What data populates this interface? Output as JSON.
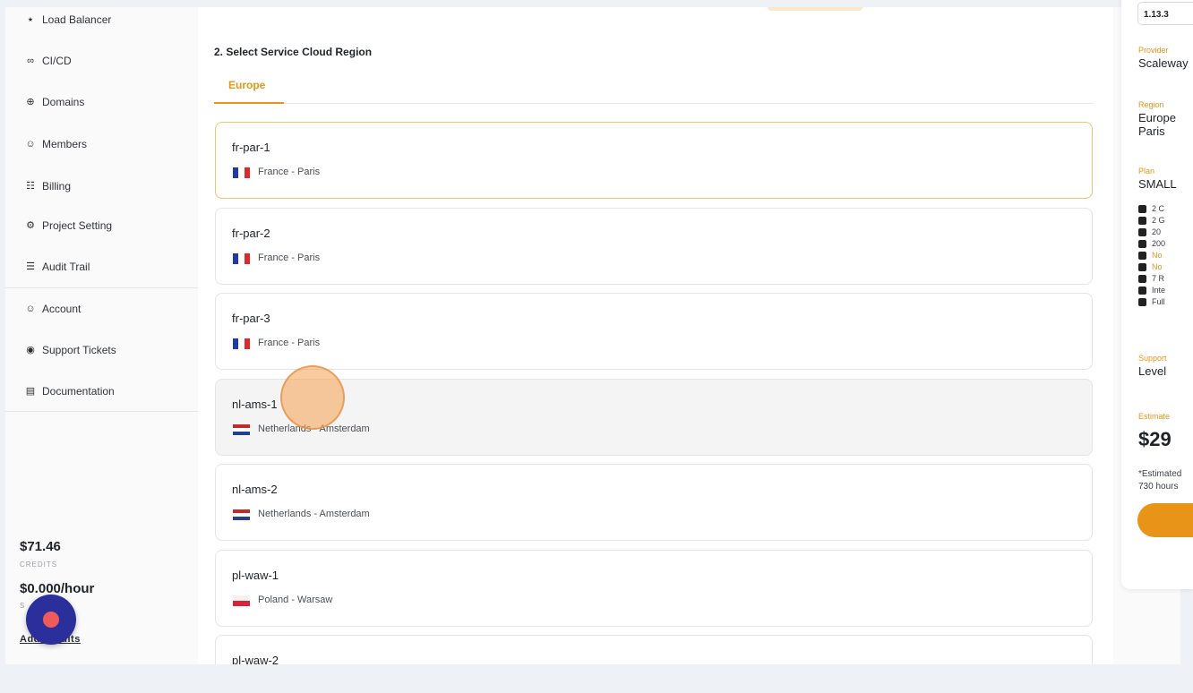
{
  "sidebar": {
    "items": [
      {
        "label": "Load Balancer",
        "icon": "load-balancer-icon"
      },
      {
        "label": "CI/CD",
        "icon": "infinity-icon"
      },
      {
        "label": "Domains",
        "icon": "globe-icon"
      },
      {
        "label": "Members",
        "icon": "user-icon"
      },
      {
        "label": "Billing",
        "icon": "document-icon"
      },
      {
        "label": "Project Setting",
        "icon": "gear-icon"
      },
      {
        "label": "Audit Trail",
        "icon": "list-icon"
      },
      {
        "label": "Account",
        "icon": "user-icon"
      },
      {
        "label": "Support Tickets",
        "icon": "lifebuoy-icon"
      },
      {
        "label": "Documentation",
        "icon": "book-icon"
      }
    ],
    "credits_amount": "$71.46",
    "credits_label": "CREDITS",
    "rate_amount": "$0.000/hour",
    "rate_sub": "S",
    "add_credits": "Add Credits"
  },
  "main": {
    "section_title": "2. Select Service Cloud Region",
    "tabs": [
      {
        "label": "Europe",
        "active": true
      }
    ],
    "regions": [
      {
        "name": "fr-par-1",
        "location": "France - Paris",
        "flag": "fr",
        "state": "selected"
      },
      {
        "name": "fr-par-2",
        "location": "France - Paris",
        "flag": "fr",
        "state": "default"
      },
      {
        "name": "fr-par-3",
        "location": "France - Paris",
        "flag": "fr",
        "state": "default"
      },
      {
        "name": "nl-ams-1",
        "location": "Netherlands - Amsterdam",
        "flag": "nl",
        "state": "hover"
      },
      {
        "name": "nl-ams-2",
        "location": "Netherlands - Amsterdam",
        "flag": "nl",
        "state": "default"
      },
      {
        "name": "pl-waw-1",
        "location": "Poland - Warsaw",
        "flag": "pl",
        "state": "default"
      },
      {
        "name": "pl-waw-2",
        "location": "",
        "flag": "",
        "state": "default"
      }
    ]
  },
  "summary": {
    "version": "1.13.3",
    "provider_label": "Provider",
    "provider_value": "Scaleway",
    "region_label": "Region",
    "region_value_1": "Europe",
    "region_value_2": "Paris",
    "plan_label": "Plan",
    "plan_value": "SMALL",
    "specs": [
      {
        "text": "2 C",
        "warn": false
      },
      {
        "text": "2 G",
        "warn": false
      },
      {
        "text": "20",
        "warn": false
      },
      {
        "text": "200",
        "warn": false
      },
      {
        "text": "No",
        "warn": true
      },
      {
        "text": "No",
        "warn": true
      },
      {
        "text": "7 R",
        "warn": false
      },
      {
        "text": "Inte",
        "warn": false
      },
      {
        "text": "Full",
        "warn": false
      }
    ],
    "support_label": "Support",
    "support_value": "Level",
    "estimate_label": "Estimate",
    "price": "$29",
    "note_1": "*Estimated",
    "note_2": "730 hours"
  },
  "colors": {
    "accent": "#e89418",
    "fab": "#2b2f9c"
  }
}
